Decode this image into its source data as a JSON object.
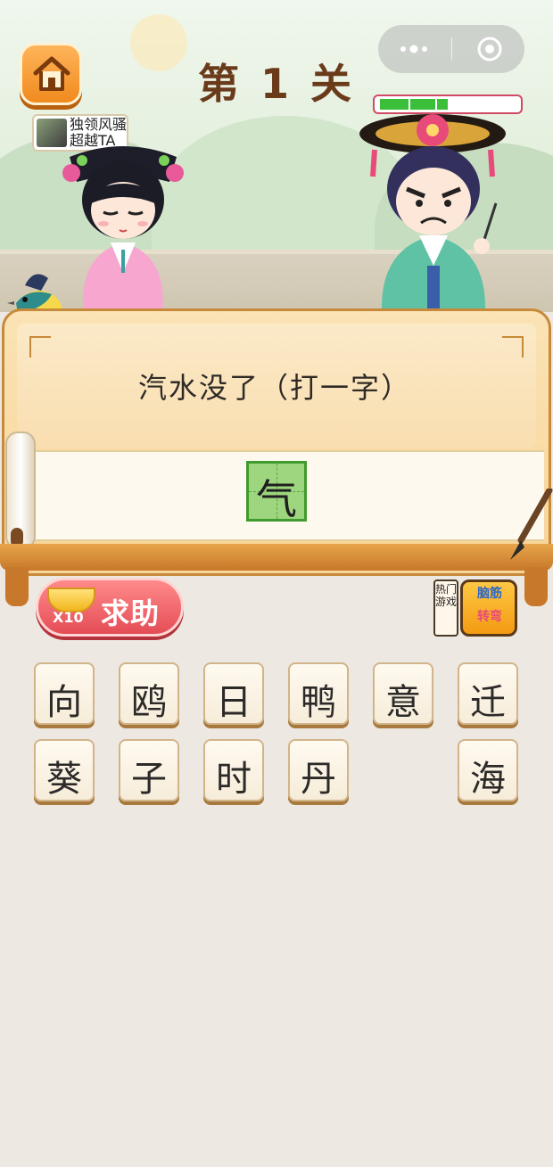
{
  "header": {
    "level_title": "第 1 关"
  },
  "promo": {
    "small_ad_text": "独领风骚超越TA"
  },
  "enemy": {
    "health_fraction": 0.5
  },
  "board": {
    "riddle": "汽水没了（打一字）",
    "answer_chars": [
      "气"
    ]
  },
  "help_button": {
    "label": "求助",
    "cost": "X10"
  },
  "hot_games": {
    "label": "热门游戏",
    "tile_text_line1": "脑筋",
    "tile_text_line2": "转弯"
  },
  "candidates": [
    [
      "向",
      "鸥",
      "日",
      "鸭",
      "意",
      "迁"
    ],
    [
      "葵",
      "子",
      "时",
      "丹",
      "",
      "海"
    ]
  ]
}
